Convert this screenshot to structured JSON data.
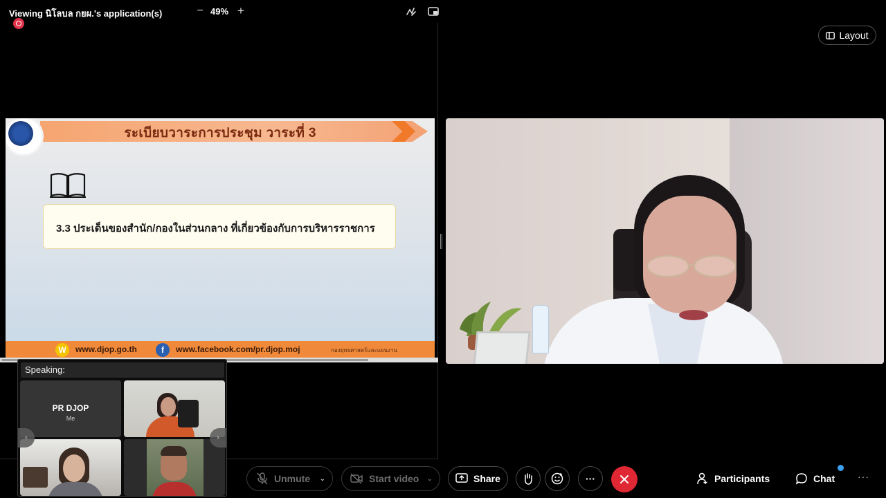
{
  "share": {
    "viewing_label": "Viewing นิโลบล กยผ.'s application(s)",
    "zoom": "49%",
    "zoom_minus": "−",
    "zoom_plus": "+",
    "icons": {
      "annotate": "annotate-icon",
      "popout": "popout-icon",
      "recording": "recording-icon"
    }
  },
  "layout_button": {
    "label": "Layout",
    "icon": "layout-icon"
  },
  "slide": {
    "title": "ระเบียบวาระการประชุม วาระที่ 3",
    "item": "3.3 ประเด็นของสำนัก/กองในส่วนกลาง ที่เกี่ยวข้องกับการบริหารราชการ",
    "footer_website": "www.djop.go.th",
    "footer_facebook": "www.facebook.com/pr.djop.moj",
    "footer_dept": "กองยุทธศาสตร์และแผนงาน",
    "footer_w_icon": "W",
    "footer_f_icon": "f",
    "colors": {
      "banner": "#f5a570",
      "arrow": "#f07a2a",
      "footer": "#f08a3a"
    }
  },
  "speaking": {
    "label": "Speaking:",
    "me_name": "PR DJOP",
    "me_tag": "Me",
    "prev": "‹",
    "next": "›"
  },
  "controls": {
    "unmute": "Unmute",
    "start_video": "Start video",
    "share": "Share",
    "more": "···",
    "participants": "Participants",
    "chat": "Chat",
    "overflow": "···",
    "colors": {
      "end_call": "#e02835",
      "chat_badge": "#3aa0f0"
    }
  }
}
